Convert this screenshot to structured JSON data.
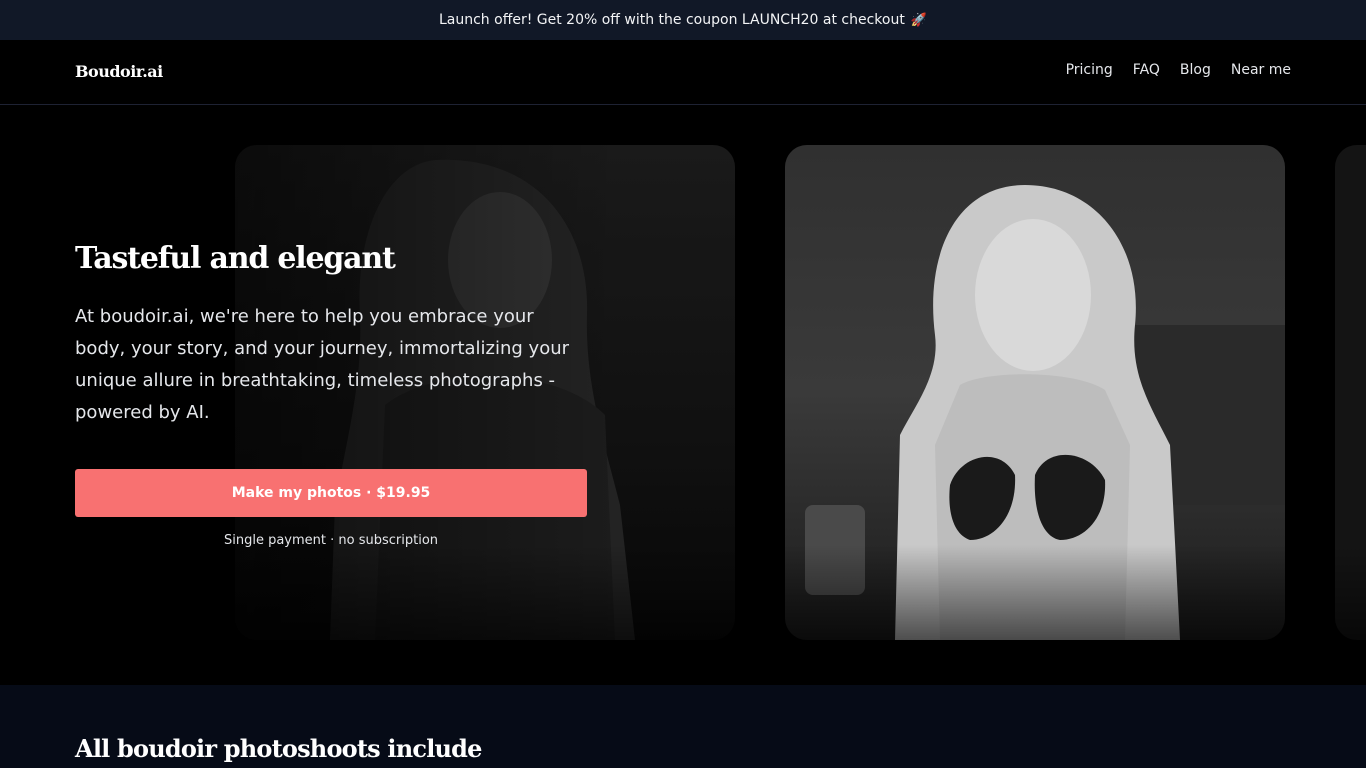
{
  "promo": {
    "text": "Launch offer! Get 20% off with the coupon LAUNCH20 at checkout",
    "icon": "rocket-icon",
    "icon_glyph": "🚀"
  },
  "nav": {
    "logo": "Boudoir.ai",
    "links": [
      "Pricing",
      "FAQ",
      "Blog",
      "Near me"
    ]
  },
  "hero": {
    "title": "Tasteful and elegant",
    "description": "At boudoir.ai, we're here to help you embrace your body, your story, and your journey, immortalizing your unique allure in breathtaking, timeless photographs - powered by AI.",
    "cta_label": "Make my photos · $19.95",
    "cta_subtext": "Single payment · no subscription"
  },
  "features": {
    "title": "All boudoir photoshoots include"
  },
  "colors": {
    "accent": "#f87171",
    "promo_bg": "#111827",
    "features_bg": "#060b17"
  }
}
